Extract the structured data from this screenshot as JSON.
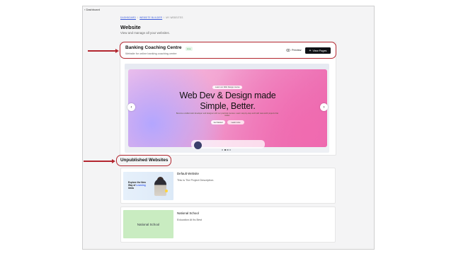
{
  "nav": {
    "back_label": "‹ Dashboard"
  },
  "breadcrumb": {
    "items": [
      "DASHBOARD",
      "WEBSITE BUILDER",
      "MY WEBSITES"
    ]
  },
  "page": {
    "title": "Website",
    "subtitle": "View and manage all your websites."
  },
  "published_site": {
    "name": "Banking Coaching Centre",
    "status": "Live",
    "description": "Website for online banking coaching centre",
    "preview_label": "Preview",
    "preview_icon": "eye-icon",
    "view_pages_label": "View Pages",
    "view_pages_icon": "plus-icon",
    "hero": {
      "pill": "Learn our Web Design course",
      "title_line1": "Web Dev & Design made",
      "title_line2": "Simple, Better.",
      "paragraph": "Become a skilled web developer and designer with our practical courses. Learn step-by-step and build real-world projects that matter.",
      "button1": "Get Started",
      "button2": "Learn more"
    },
    "carousel": {
      "prev_icon": "chevron-left-icon",
      "next_icon": "chevron-right-icon",
      "slides": 4,
      "active": 2
    }
  },
  "unpublished": {
    "title": "Unpublished Websites",
    "items": [
      {
        "name": "Default Website",
        "description": "This is The Project Description.",
        "thumb_line1": "Explore the New",
        "thumb_line2": "Way of",
        "thumb_accent": "Learning",
        "thumb_line3": "Ideas"
      },
      {
        "name": "National School",
        "description": "Education At Its Best",
        "thumb_label": "National School"
      }
    ]
  },
  "colors": {
    "annotation": "#b3262f",
    "primary_button": "#0f1115",
    "badge_green": "#2f9e44",
    "hero_pink": "#ef86c1"
  }
}
